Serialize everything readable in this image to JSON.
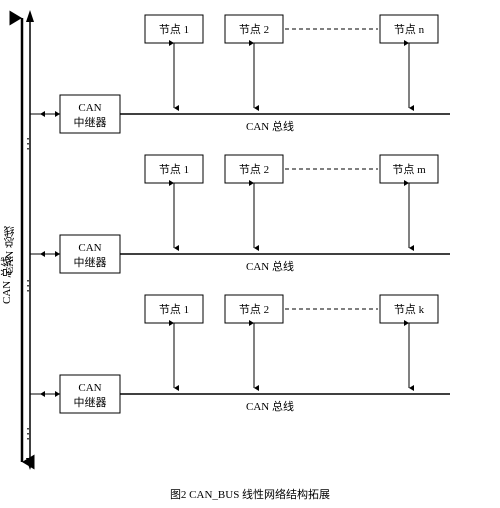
{
  "title": "图2 CAN_BUS 线性网络结构拓展",
  "left_label": "CAN 总线",
  "sections": [
    {
      "nodes": [
        "节点 1",
        "节点 2",
        "节点 n"
      ],
      "repeater": [
        "CAN",
        "中继器"
      ],
      "bus_label": "CAN 总线"
    },
    {
      "nodes": [
        "节点 1",
        "节点 2",
        "节点 m"
      ],
      "repeater": [
        "CAN",
        "中继器"
      ],
      "bus_label": "CAN 总线"
    },
    {
      "nodes": [
        "节点 1",
        "节点 2",
        "节点 k"
      ],
      "repeater": [
        "CAN",
        "中继器"
      ],
      "bus_label": "CAN 总线"
    }
  ],
  "caption": "图2 CAN_BUS 线性网络结构拓展"
}
